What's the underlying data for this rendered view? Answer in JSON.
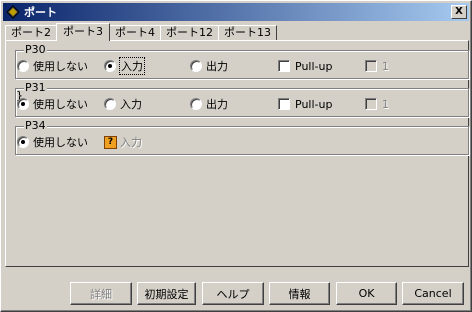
{
  "window": {
    "title": "ポート",
    "close_label": "X"
  },
  "tabs": [
    {
      "label": "ポート2",
      "active": false
    },
    {
      "label": "ポート3",
      "active": true
    },
    {
      "label": "ポート4",
      "active": false
    },
    {
      "label": "ポート12",
      "active": false
    },
    {
      "label": "ポート13",
      "active": false
    }
  ],
  "groups": [
    {
      "name": "P30",
      "unused_label": "使用しない",
      "unused_checked": false,
      "input_label": "入力",
      "input_checked": true,
      "output_label": "出力",
      "output_checked": false,
      "pullup_label": "Pull-up",
      "pullup_checked": false,
      "value_label": "1",
      "value_checked": false
    },
    {
      "name": "P31",
      "unused_label": "使用しない",
      "unused_checked": true,
      "input_label": "入力",
      "input_checked": false,
      "output_label": "出力",
      "output_checked": false,
      "pullup_label": "Pull-up",
      "pullup_checked": false,
      "value_label": "1",
      "value_checked": false
    },
    {
      "name": "P34",
      "unused_label": "使用しない",
      "unused_checked": true,
      "input_label": "入力",
      "help_icon_glyph": "?"
    }
  ],
  "buttons": {
    "details": "詳細",
    "initial_settings": "初期設定",
    "help": "ヘルプ",
    "info": "情報",
    "ok": "OK",
    "cancel": "Cancel"
  },
  "colors": {
    "titlebar_start": "#0a246a",
    "titlebar_end": "#a6caf0",
    "face": "#d4d0c8"
  }
}
